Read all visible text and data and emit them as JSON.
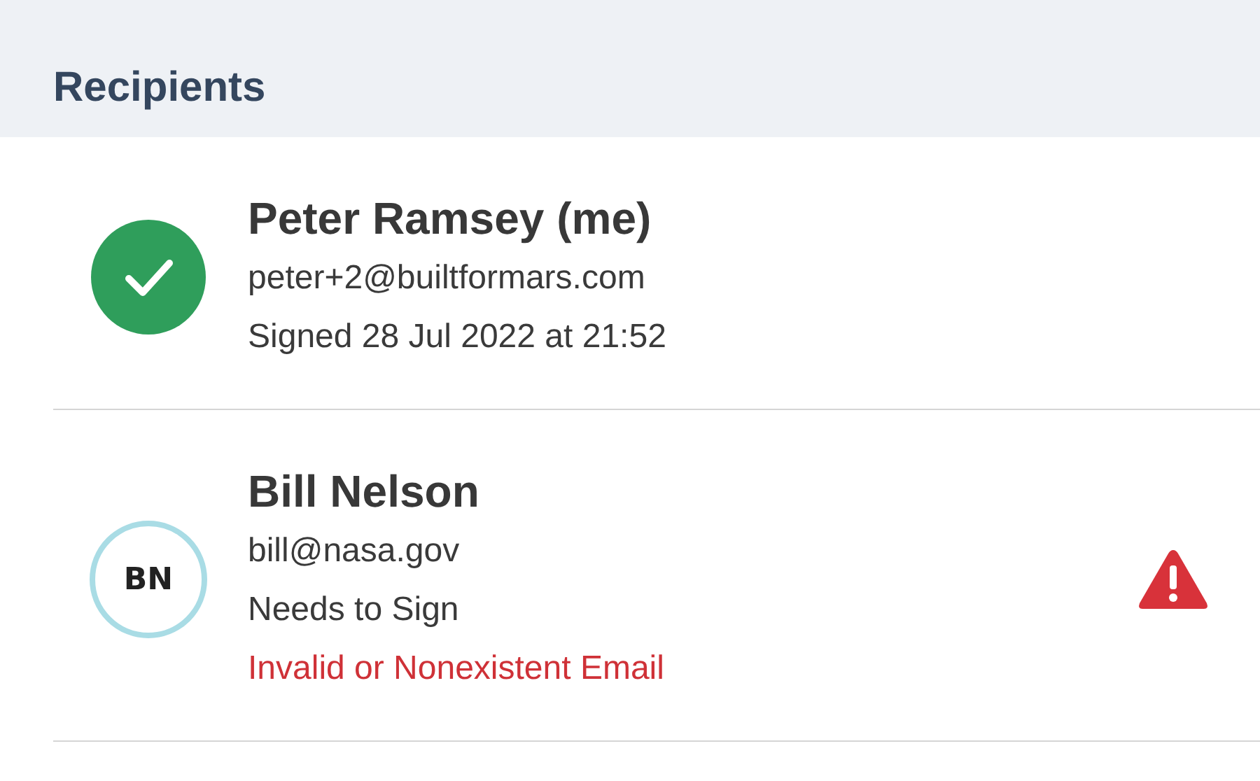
{
  "section": {
    "title": "Recipients"
  },
  "recipients": [
    {
      "name": "Peter Ramsey (me)",
      "email": "peter+2@builtformars.com",
      "status": "Signed 28 Jul 2022 at 21:52",
      "kind": "check",
      "warning": false
    },
    {
      "name": "Bill Nelson",
      "email": "bill@nasa.gov",
      "status": "Needs to Sign",
      "kind": "initials",
      "initials": "BN",
      "error": "Invalid or Nonexistent Email",
      "warning": true
    }
  ]
}
